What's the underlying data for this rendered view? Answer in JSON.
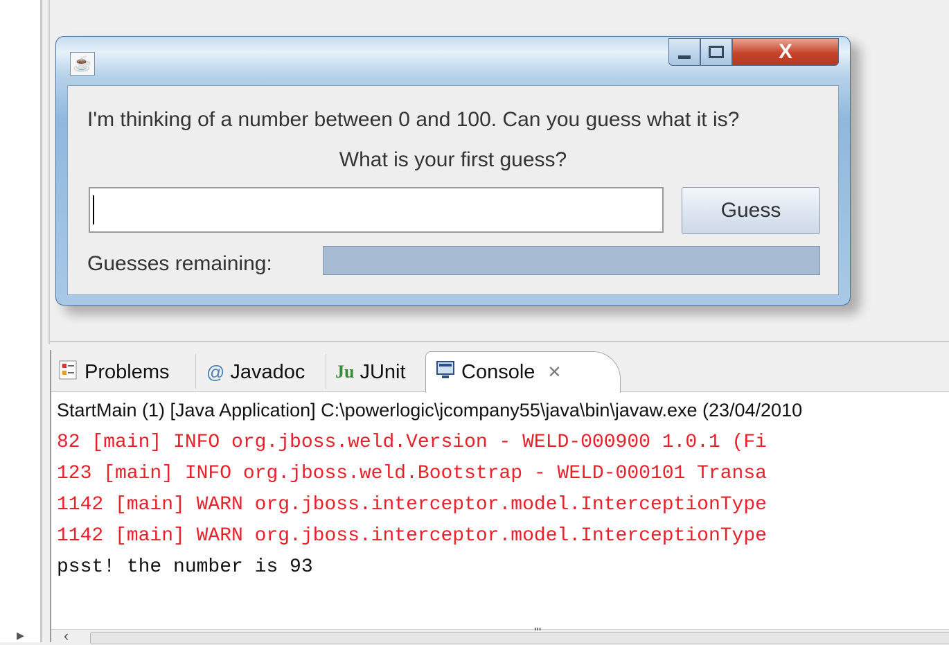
{
  "dialog": {
    "message": "I'm thinking of a number between 0 and 100. Can you guess what it is?",
    "prompt": "What is your first guess?",
    "guess_input_value": "",
    "guess_button": "Guess",
    "remaining_label": "Guesses remaining:",
    "remaining_progress": 1.0,
    "close_glyph": "X"
  },
  "tabs": [
    {
      "label": "Problems",
      "icon": "problems-icon"
    },
    {
      "label": "Javadoc",
      "icon": "at-icon",
      "glyph": "@"
    },
    {
      "label": "JUnit",
      "icon": "junit-icon",
      "glyph": "Ju"
    },
    {
      "label": "Console",
      "icon": "console-icon",
      "active": true
    }
  ],
  "console": {
    "launch_info": "StartMain (1) [Java Application] C:\\powerlogic\\jcompany55\\java\\bin\\javaw.exe (23/04/2010",
    "lines": [
      {
        "text": "82 [main] INFO org.jboss.weld.Version - WELD-000900 1.0.1 (Fi",
        "kind": "err"
      },
      {
        "text": "123 [main] INFO org.jboss.weld.Bootstrap - WELD-000101 Transa",
        "kind": "err"
      },
      {
        "text": "1142 [main] WARN org.jboss.interceptor.model.InterceptionType",
        "kind": "err"
      },
      {
        "text": "1142 [main] WARN org.jboss.interceptor.model.InterceptionType",
        "kind": "err"
      },
      {
        "text": "psst! the number is 93",
        "kind": "out"
      }
    ],
    "scroll_grip": "'''"
  },
  "colors": {
    "error_text": "#e8202a",
    "normal_text": "#111111",
    "dialog_frame": "#8fb8dd"
  }
}
